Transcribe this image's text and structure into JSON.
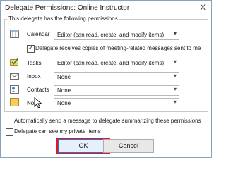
{
  "window": {
    "title": "Delegate Permissions: Online Instructor",
    "close_glyph": "X"
  },
  "group_label": "This delegate has the following permissions",
  "calendar": {
    "label": "Calendar",
    "value": "Editor (can read, create, and modify items)"
  },
  "meeting_copies": {
    "checked": true,
    "label": "Delegate receives copies of meeting-related messages sent to me"
  },
  "tasks": {
    "label": "Tasks",
    "value": "Editor (can read, create, and modify items)"
  },
  "inbox": {
    "label": "Inbox",
    "value": "None"
  },
  "contacts": {
    "label": "Contacts",
    "value": "None"
  },
  "notes": {
    "label": "No",
    "value": "None"
  },
  "auto_message": {
    "checked": false,
    "label": "Automatically send a message to delegate summarizing these permissions"
  },
  "private_items": {
    "checked": false,
    "label": "Delegate can see my private items"
  },
  "buttons": {
    "ok": "OK",
    "cancel": "Cancel"
  },
  "colors": {
    "highlight": "#d81b24",
    "accent": "#2b6fd4"
  }
}
